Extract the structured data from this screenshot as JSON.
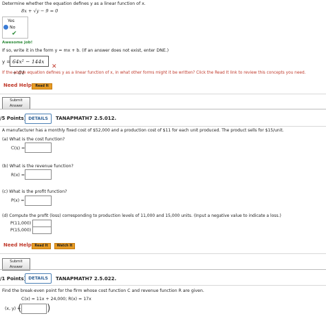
{
  "q1": {
    "prompt": "Determine whether the equation defines y as a linear function of x.",
    "equation": "8x + √y − 9 = 0",
    "choice_yes": "Yes",
    "choice_no": "No",
    "selected": "No",
    "feedback": "Awesome job!",
    "instruction": "If so, write it in the form y = mx + b. (If an answer does not exist, enter DNE.)",
    "y_label": "y =",
    "answer_value": "64x² − 144x + 81",
    "hint": "If the above equation defines y as a linear function of x, in what other forms might it be written? Click the Read It link to review this concepts you need.",
    "need_help": "Need Help?",
    "read_it": "Read It",
    "submit": "Submit Answer"
  },
  "q2": {
    "points": "/5 Points]",
    "details": "DETAILS",
    "id": "TANAPMATH7 2.5.012.",
    "intro": "A manufacturer has a monthly fixed cost of $52,000 and a production cost of $11 for each unit produced. The product sells for $15/unit.",
    "a_prompt": "(a)   What is the cost function?",
    "a_label": "C(x) =",
    "b_prompt": "(b)   What is the revenue function?",
    "b_label": "R(x) =",
    "c_prompt": "(c)   What is the profit function?",
    "c_label": "P(x) =",
    "d_prompt": "(d)   Compute the profit (loss) corresponding to production levels of 11,000 and 15,000 units. (Input a negative value to indicate a loss.)",
    "d_label1": "P(11,000) =",
    "d_label2": "P(15,000) =",
    "need_help": "Need Help?",
    "read_it": "Read It",
    "watch_it": "Watch It",
    "submit": "Submit Answer"
  },
  "q3": {
    "points": "/1 Points]",
    "details": "DETAILS",
    "id": "TANAPMATH7 2.5.022.",
    "prompt": "Find the break-even point for the firm whose cost function C and revenue function R are given.",
    "functions": "C(x) = 11x + 24,000;  R(x) = 17x",
    "label": "(x, y) ="
  },
  "colors": {
    "accent": "#2a5d93",
    "error": "#c0392b",
    "success": "#2e8b3a",
    "read_it": "#e79b24"
  }
}
